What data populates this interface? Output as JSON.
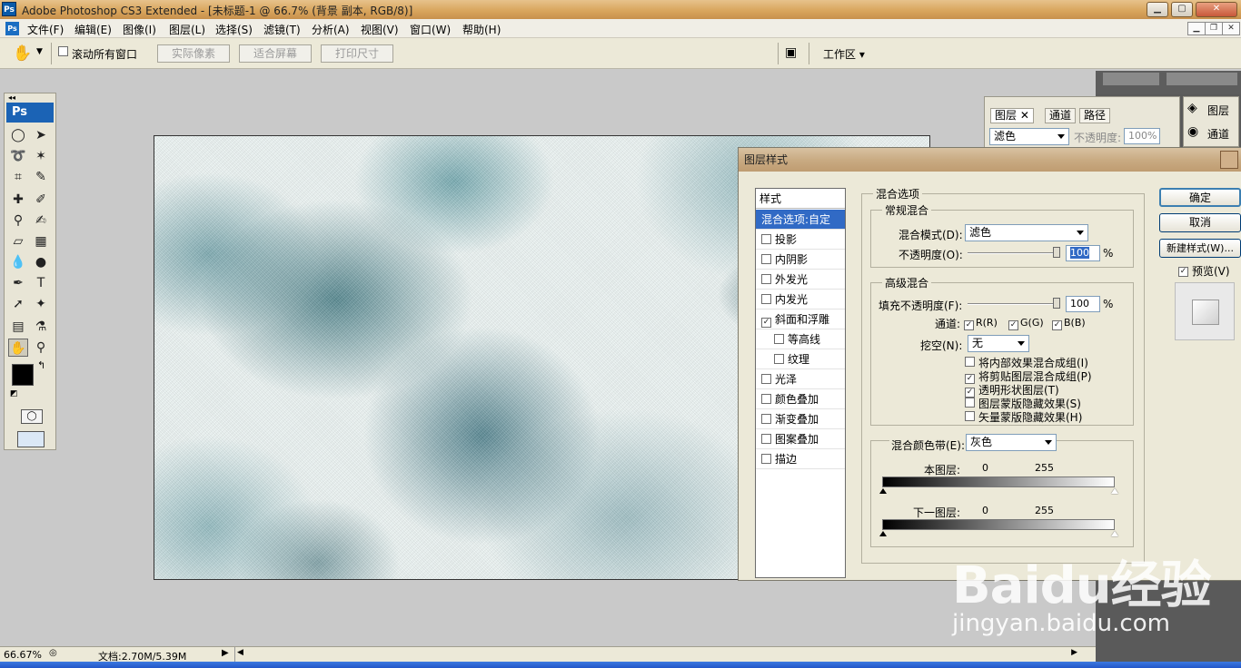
{
  "app": {
    "title": "Adobe Photoshop CS3 Extended - [未标题-1 @ 66.7% (背景 副本, RGB/8)]",
    "logo_text": "Ps"
  },
  "menu": [
    "文件(F)",
    "编辑(E)",
    "图像(I)",
    "图层(L)",
    "选择(S)",
    "滤镜(T)",
    "分析(A)",
    "视图(V)",
    "窗口(W)",
    "帮助(H)"
  ],
  "options": {
    "scroll_all": "滚动所有窗口",
    "actual_pixels": "实际像素",
    "fit_screen": "适合屏幕",
    "print_size": "打印尺寸",
    "workspace": "工作区"
  },
  "layers_panel": {
    "tabs": [
      "图层",
      "通道",
      "路径"
    ],
    "blend_mode": "滤色",
    "opacity_label": "不透明度:",
    "opacity_value": "100%"
  },
  "side_panel": {
    "layers_label": "图层",
    "channels_label": "通道"
  },
  "dialog": {
    "title": "图层样式",
    "styles_header": "样式",
    "styles": [
      {
        "label": "混合选项:自定",
        "checked": null,
        "selected": true,
        "indent": false
      },
      {
        "label": "投影",
        "checked": false,
        "selected": false,
        "indent": false
      },
      {
        "label": "内阴影",
        "checked": false,
        "selected": false,
        "indent": false
      },
      {
        "label": "外发光",
        "checked": false,
        "selected": false,
        "indent": false
      },
      {
        "label": "内发光",
        "checked": false,
        "selected": false,
        "indent": false
      },
      {
        "label": "斜面和浮雕",
        "checked": true,
        "selected": false,
        "indent": false
      },
      {
        "label": "等高线",
        "checked": false,
        "selected": false,
        "indent": true
      },
      {
        "label": "纹理",
        "checked": false,
        "selected": false,
        "indent": true
      },
      {
        "label": "光泽",
        "checked": false,
        "selected": false,
        "indent": false
      },
      {
        "label": "颜色叠加",
        "checked": false,
        "selected": false,
        "indent": false
      },
      {
        "label": "渐变叠加",
        "checked": false,
        "selected": false,
        "indent": false
      },
      {
        "label": "图案叠加",
        "checked": false,
        "selected": false,
        "indent": false
      },
      {
        "label": "描边",
        "checked": false,
        "selected": false,
        "indent": false
      }
    ],
    "blend_options_title": "混合选项",
    "general_blend": {
      "title": "常规混合",
      "mode_label": "混合模式(D):",
      "mode_value": "滤色",
      "opacity_label": "不透明度(O):",
      "opacity_value": "100",
      "opacity_unit": "%"
    },
    "advanced_blend": {
      "title": "高级混合",
      "fill_label": "填充不透明度(F):",
      "fill_value": "100",
      "fill_unit": "%",
      "channels_label": "通道:",
      "channel_r": "R(R)",
      "channel_g": "G(G)",
      "channel_b": "B(B)",
      "knockout_label": "挖空(N):",
      "knockout_value": "无",
      "checks": [
        {
          "label": "将内部效果混合成组(I)",
          "checked": false
        },
        {
          "label": "将剪贴图层混合成组(P)",
          "checked": true
        },
        {
          "label": "透明形状图层(T)",
          "checked": true
        },
        {
          "label": "图层蒙版隐藏效果(S)",
          "checked": false
        },
        {
          "label": "矢量蒙版隐藏效果(H)",
          "checked": false
        }
      ]
    },
    "blend_if": {
      "label": "混合颜色带(E):",
      "value": "灰色",
      "this_layer": "本图层:",
      "underlying": "下一图层:",
      "min": "0",
      "max": "255"
    },
    "buttons": {
      "ok": "确定",
      "cancel": "取消",
      "new_style": "新建样式(W)...",
      "preview": "预览(V)"
    }
  },
  "status": {
    "zoom": "66.67%",
    "doc": "文档:2.70M/5.39M"
  },
  "watermark": {
    "logo": "Baidu经验",
    "url": "jingyan.baidu.com"
  }
}
